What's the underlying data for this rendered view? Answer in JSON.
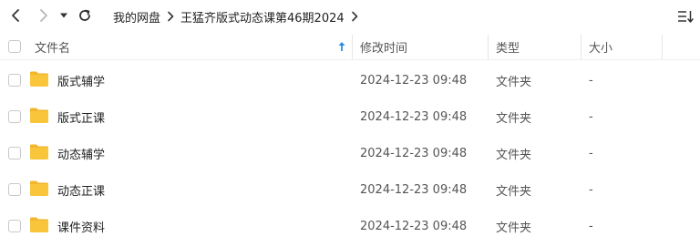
{
  "nav": {
    "back_icon": "chevron-left-icon",
    "forward_icon": "chevron-right-icon",
    "history_icon": "caret-down-icon",
    "refresh_icon": "refresh-icon"
  },
  "breadcrumb": {
    "items": [
      "我的网盘",
      "王猛齐版式动态课第46期2024"
    ]
  },
  "toolbar": {
    "sort_icon": "sort-list-icon"
  },
  "table": {
    "columns": {
      "name": "文件名",
      "modified": "修改时间",
      "type": "类型",
      "size": "大小"
    },
    "sort_icon": "sort-ascending-arrow-icon",
    "rows": [
      {
        "name": "版式辅学",
        "modified": "2024-12-23 09:48",
        "type": "文件夹",
        "size": "-"
      },
      {
        "name": "版式正课",
        "modified": "2024-12-23 09:48",
        "type": "文件夹",
        "size": "-"
      },
      {
        "name": "动态辅学",
        "modified": "2024-12-23 09:48",
        "type": "文件夹",
        "size": "-"
      },
      {
        "name": "动态正课",
        "modified": "2024-12-23 09:48",
        "type": "文件夹",
        "size": "-"
      },
      {
        "name": "课件资料",
        "modified": "2024-12-23 09:48",
        "type": "文件夹",
        "size": "-"
      }
    ]
  },
  "colors": {
    "folder": "#f9c63b",
    "folder_tab": "#f2b52c",
    "sort_arrow": "#2a8de8"
  }
}
